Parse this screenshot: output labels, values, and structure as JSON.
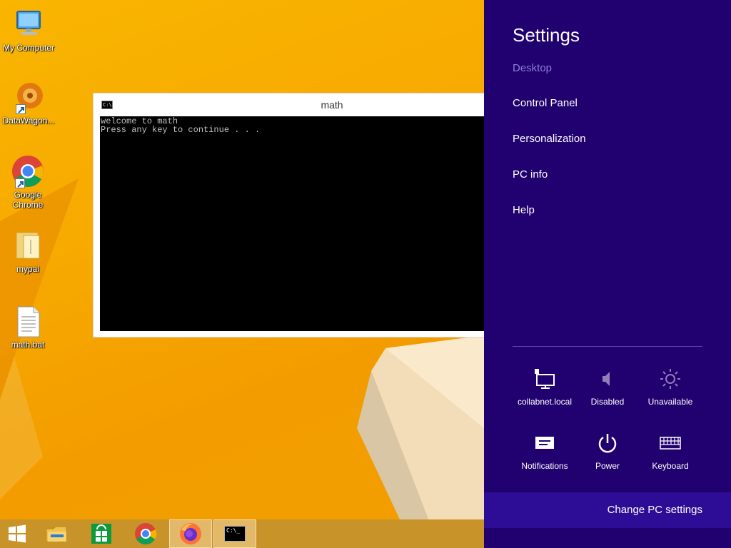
{
  "desktop": {
    "icons": [
      {
        "label": "My Computer",
        "icon": "computer-icon"
      },
      {
        "label": "DataWagon...",
        "icon": "datawagon-icon"
      },
      {
        "label": "Google\nChrome",
        "icon": "chrome-icon"
      },
      {
        "label": "mypal",
        "icon": "folder-icon"
      },
      {
        "label": "math.bat",
        "icon": "batch-file-icon"
      }
    ]
  },
  "console": {
    "title": "math",
    "title_icon_text": "C:\\",
    "lines": [
      "welcome to math",
      "Press any key to continue . . ."
    ]
  },
  "charm": {
    "heading": "Settings",
    "context": "Desktop",
    "menu": [
      "Control Panel",
      "Personalization",
      "PC info",
      "Help"
    ],
    "quick": [
      {
        "label": "collabnet.local",
        "icon": "network-icon"
      },
      {
        "label": "Disabled",
        "icon": "volume-icon"
      },
      {
        "label": "Unavailable",
        "icon": "brightness-icon"
      },
      {
        "label": "Notifications",
        "icon": "notifications-icon"
      },
      {
        "label": "Power",
        "icon": "power-icon"
      },
      {
        "label": "Keyboard",
        "icon": "keyboard-icon"
      }
    ],
    "change_pc": "Change PC settings",
    "colors": {
      "background": "#21006f",
      "accent": "#2e0d96",
      "dim_text": "#8b7fd9"
    }
  },
  "taskbar": {
    "items": [
      "start-icon",
      "file-explorer-icon",
      "store-icon",
      "chrome-icon",
      "firefox-icon",
      "command-prompt-icon"
    ],
    "active": [
      "firefox-icon",
      "command-prompt-icon"
    ],
    "cmd_icon_text": "C:\\_"
  }
}
